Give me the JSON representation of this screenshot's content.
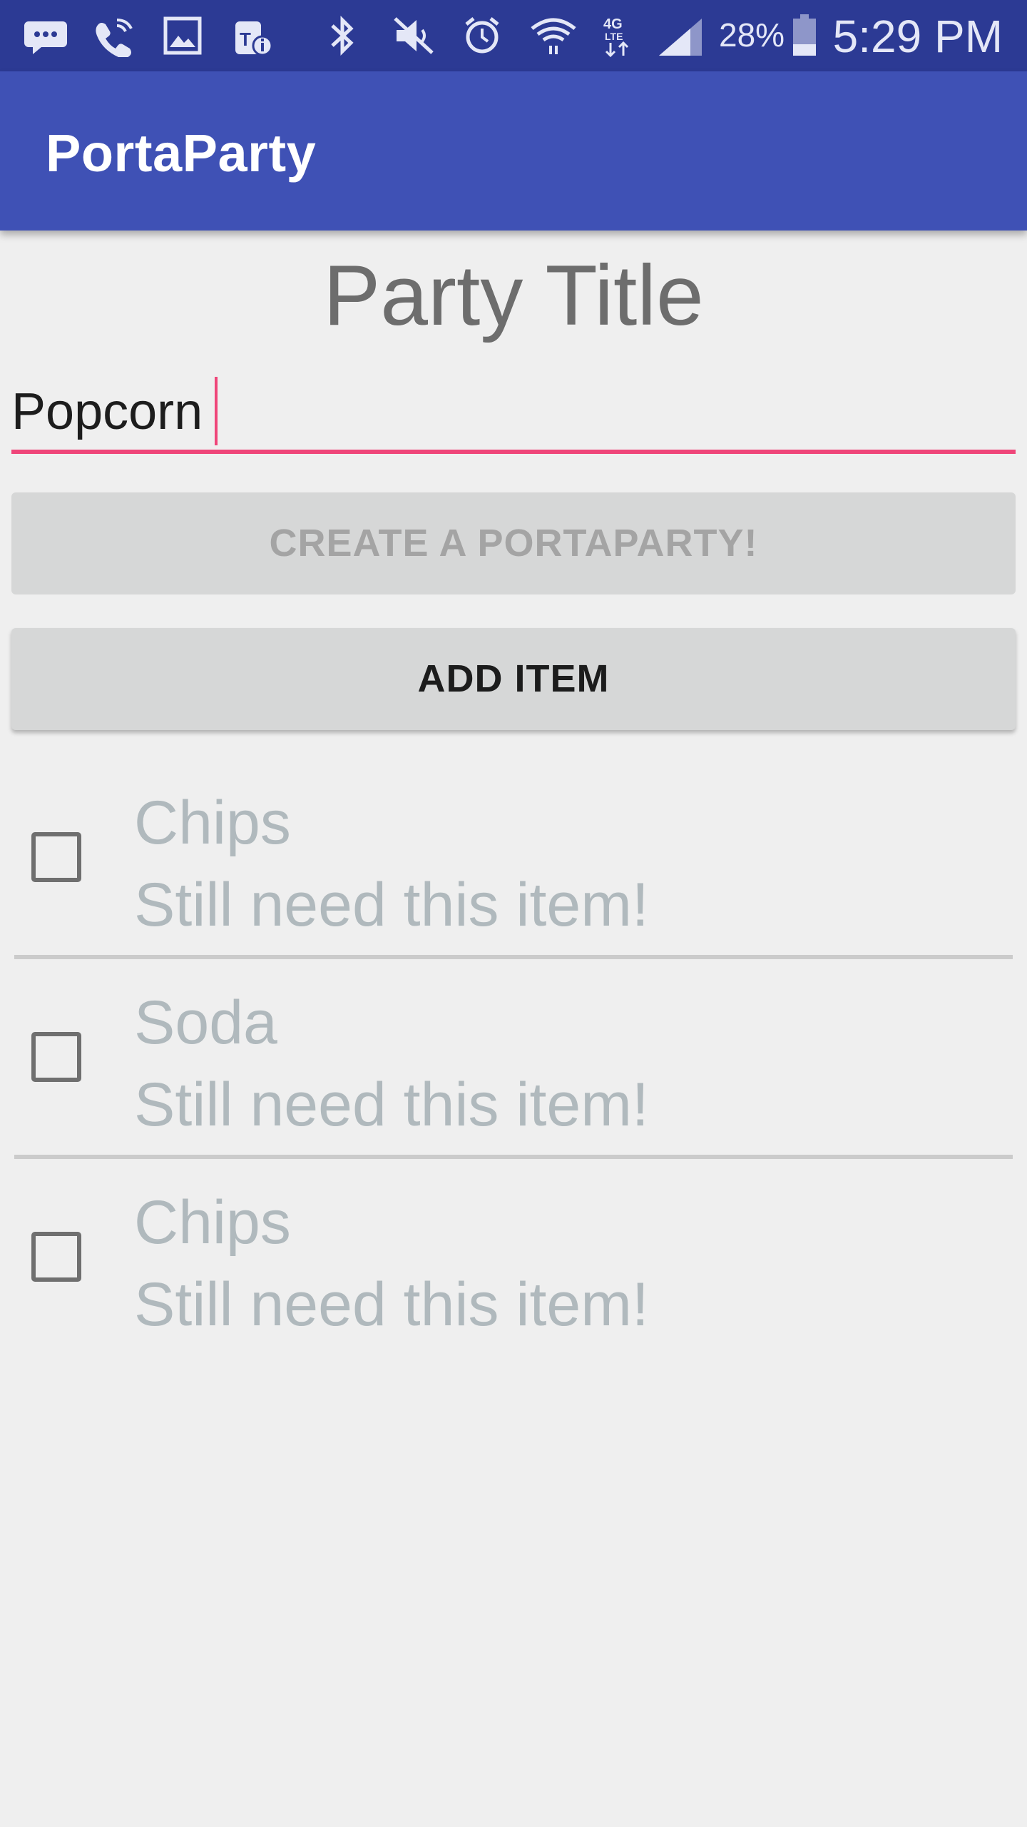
{
  "status_bar": {
    "icons": [
      "messages-icon",
      "wifi-calling-icon",
      "gallery-icon",
      "tmobile-info-icon",
      "bluetooth-icon",
      "mute-icon",
      "alarm-icon",
      "wifi-icon",
      "lte-icon",
      "signal-icon",
      "battery-icon"
    ],
    "battery_percent": "28%",
    "time": "5:29 PM"
  },
  "app_bar": {
    "title": "PortaParty",
    "color": "#3f51b5"
  },
  "main": {
    "party_title": "Party Title",
    "item_input": {
      "value": "Popcorn",
      "accent_color": "#ef4579"
    },
    "create_button": "CREATE A PORTAPARTY!",
    "add_item_button": "ADD ITEM",
    "items": [
      {
        "name": "Chips",
        "status": "Still need this item!",
        "checked": false
      },
      {
        "name": "Soda",
        "status": "Still need this item!",
        "checked": false
      },
      {
        "name": "Chips",
        "status": "Still need this item!",
        "checked": false
      }
    ]
  }
}
